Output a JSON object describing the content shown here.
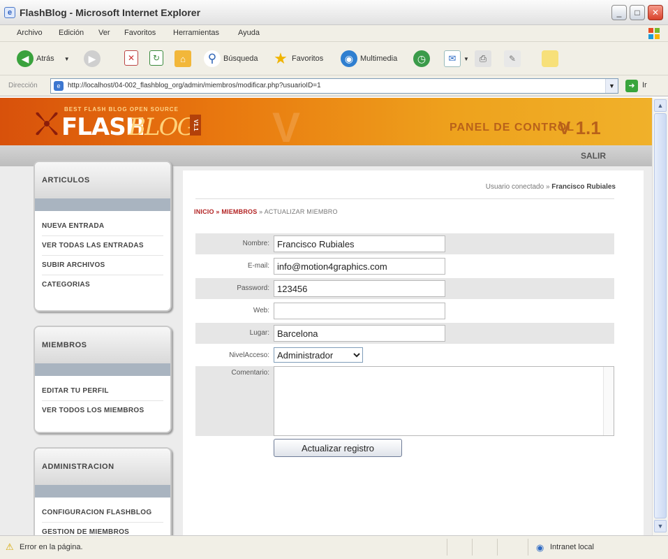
{
  "window": {
    "title": "FlashBlog - Microsoft Internet Explorer",
    "buttons": {
      "minimize": "_",
      "maximize": "□",
      "close": "✕"
    }
  },
  "menubar": [
    "Archivo",
    "Edición",
    "Ver",
    "Favoritos",
    "Herramientas",
    "Ayuda"
  ],
  "toolbar": {
    "back": "Atrás",
    "search": "Búsqueda",
    "favorites": "Favoritos",
    "multimedia": "Multimedia"
  },
  "address": {
    "label": "Dirección",
    "url": "http://localhost/04-002_flashblog_org/admin/miembros/modificar.php?usuarioID=1",
    "go": "Ir"
  },
  "banner": {
    "tagline": "BEST FLASH BLOG OPEN SOURCE",
    "logo_flash": "FLASH",
    "logo_blog": "BLOG",
    "logo_version": "V1.1",
    "panel_title": "PANEL DE CONTROL",
    "panel_version": "V 1.1"
  },
  "topnav": {
    "logout": "SALIR"
  },
  "sidebar": {
    "articulos": {
      "title": "ARTICULOS",
      "items": [
        "NUEVA ENTRADA",
        "VER TODAS LAS ENTRADAS",
        "SUBIR ARCHIVOS",
        "CATEGORIAS"
      ]
    },
    "miembros": {
      "title": "MIEMBROS",
      "items": [
        "EDITAR TU PERFIL",
        "VER TODOS LOS MIEMBROS"
      ]
    },
    "administracion": {
      "title": "ADMINISTRACION",
      "items": [
        "CONFIGURACION FLASHBLOG",
        "GESTION DE MIEMBROS"
      ]
    }
  },
  "content": {
    "user_prefix": "Usuario conectado »",
    "user_name": "Francisco Rubiales",
    "breadcrumb": {
      "inicio": "INICIO",
      "sep": "»",
      "miembros": "MIEMBROS",
      "current": "ACTUALIZAR MIEMBRO"
    },
    "form": {
      "nombre": {
        "label": "Nombre:",
        "value": "Francisco Rubiales"
      },
      "email": {
        "label": "E-mail:",
        "value": "info@motion4graphics.com"
      },
      "password": {
        "label": "Password:",
        "value": "123456"
      },
      "web": {
        "label": "Web:",
        "value": ""
      },
      "lugar": {
        "label": "Lugar:",
        "value": "Barcelona"
      },
      "nivel": {
        "label": "NivelAcceso:",
        "value": "Administrador"
      },
      "comentario": {
        "label": "Comentario:",
        "value": ""
      },
      "submit": "Actualizar registro"
    }
  },
  "statusbar": {
    "message": "Error en la página.",
    "zone": "Intranet local"
  }
}
